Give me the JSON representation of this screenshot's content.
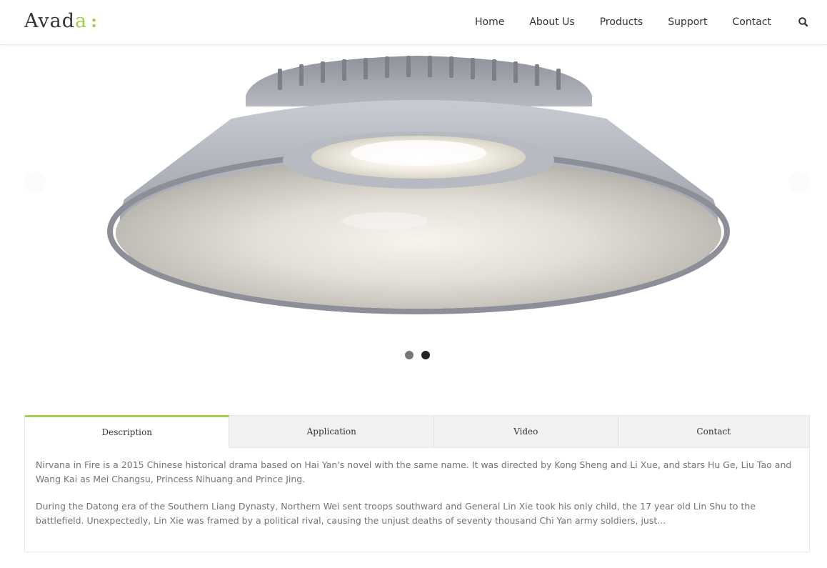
{
  "header": {
    "logo": {
      "text_main": "Avad",
      "text_accent": "a",
      "text_colon": ":"
    },
    "nav": [
      "Home",
      "About Us",
      "Products",
      "Support",
      "Contact"
    ],
    "search_icon": "search-icon"
  },
  "slider": {
    "image": "high-bay-led-lamp",
    "slide_count": 2,
    "active_slide": 2
  },
  "tabs": {
    "labels": [
      "Description",
      "Application",
      "Video",
      "Contact"
    ],
    "active": "Description",
    "description": {
      "p1": "Nirvana in Fire is a 2015 Chinese historical drama based on Hai Yan's novel with the same name. It was directed by Kong Sheng and Li Xue, and stars Hu Ge, Liu Tao and Wang Kai as Mei Changsu, Princess Nihuang and Prince Jing.",
      "p2": "During the Datong era of the Southern Liang Dynasty, Northern Wei sent troops southward and General Lin Xie took his only child, the 17 year old Lin Shu to the battlefield. Unexpectedly, Lin Xie was framed by a political rival, causing the unjust deaths of seventy thousand Chi Yan army soldiers, just..."
    }
  },
  "colors": {
    "accent": "#a0ce4e",
    "text": "#747474",
    "heading": "#333333"
  }
}
